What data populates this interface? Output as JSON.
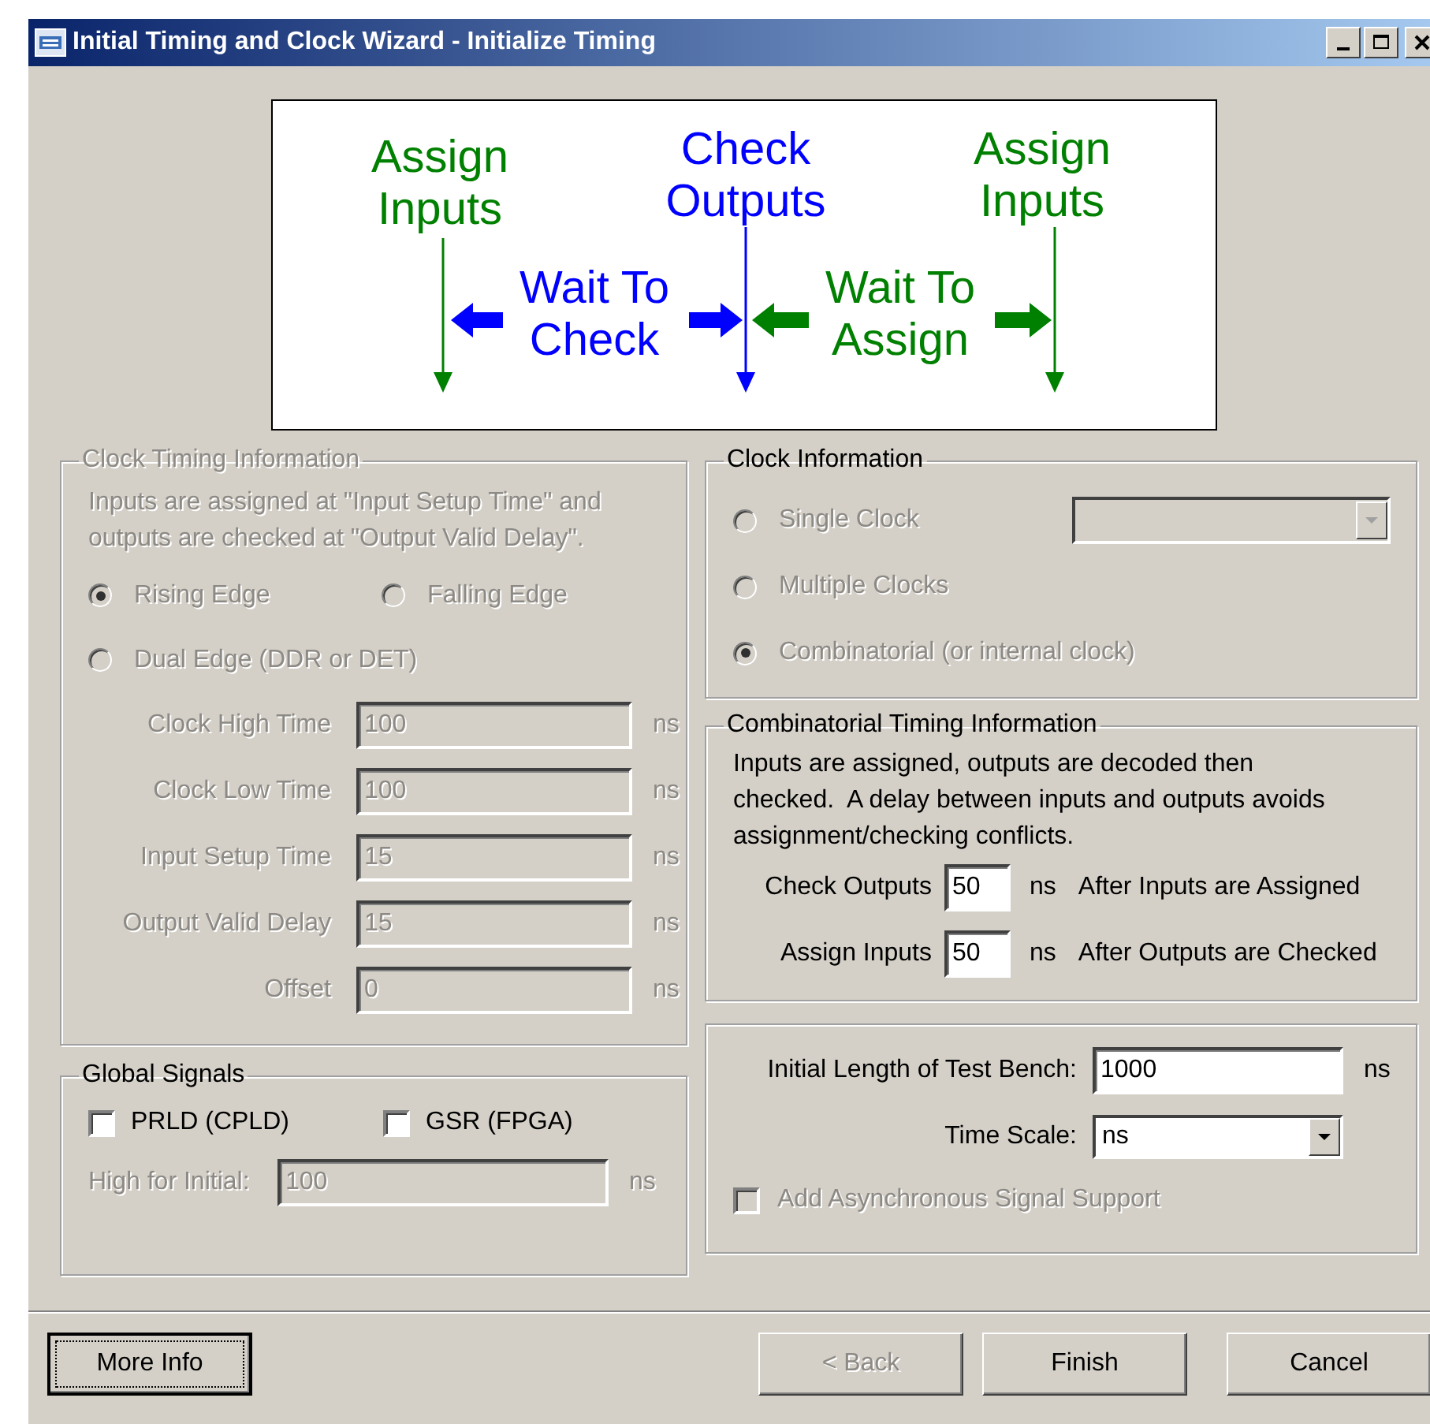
{
  "window": {
    "title": "Initial Timing and Clock Wizard - Initialize Timing"
  },
  "diagram": {
    "labels": [
      {
        "lines": [
          "Assign",
          "Inputs"
        ],
        "color": "#008000"
      },
      {
        "lines": [
          "Check",
          "Outputs"
        ],
        "color": "#0000ff"
      },
      {
        "lines": [
          "Assign",
          "Inputs"
        ],
        "color": "#008000"
      },
      {
        "lines": [
          "Wait To",
          "Check"
        ],
        "color": "#0000ff"
      },
      {
        "lines": [
          "Wait To",
          "Assign"
        ],
        "color": "#008000"
      }
    ]
  },
  "clock_timing": {
    "title": "Clock Timing Information",
    "disabled": true,
    "description": "Inputs are assigned at \"Input Setup Time\" and outputs are checked at \"Output Valid Delay\".",
    "edge_options": [
      {
        "label": "Rising Edge",
        "selected": true
      },
      {
        "label": "Falling Edge",
        "selected": false
      },
      {
        "label": "Dual Edge (DDR or DET)",
        "selected": false
      }
    ],
    "fields": [
      {
        "label": "Clock High Time",
        "value": "100",
        "unit": "ns"
      },
      {
        "label": "Clock Low Time",
        "value": "100",
        "unit": "ns"
      },
      {
        "label": "Input Setup Time",
        "value": "15",
        "unit": "ns"
      },
      {
        "label": "Output Valid Delay",
        "value": "15",
        "unit": "ns"
      },
      {
        "label": "Offset",
        "value": "0",
        "unit": "ns"
      }
    ]
  },
  "clock_information": {
    "title": "Clock Information",
    "disabled": true,
    "options": [
      {
        "label": "Single Clock",
        "selected": false
      },
      {
        "label": "Multiple Clocks",
        "selected": false
      },
      {
        "label": "Combinatorial (or internal clock)",
        "selected": true
      }
    ]
  },
  "combinatorial_timing": {
    "title": "Combinatorial Timing Information",
    "description_lines": [
      "Inputs are assigned, outputs are decoded then",
      "checked.  A delay between inputs and outputs avoids",
      "assignment/checking conflicts."
    ],
    "fields": [
      {
        "label": "Check Outputs",
        "value": "50",
        "unit": "ns",
        "note": "After Inputs are Assigned"
      },
      {
        "label": "Assign Inputs",
        "value": "50",
        "unit": "ns",
        "note": "After Outputs are Checked"
      }
    ]
  },
  "global_signals": {
    "title": "Global Signals",
    "checkboxes": [
      {
        "label": "PRLD (CPLD)",
        "checked": false
      },
      {
        "label": "GSR (FPGA)",
        "checked": false
      }
    ],
    "high_for_initial": {
      "label": "High for Initial:",
      "value": "100",
      "unit": "ns",
      "disabled": true
    }
  },
  "test_bench": {
    "length": {
      "label": "Initial Length of Test Bench:",
      "value": "1000",
      "unit": "ns"
    },
    "time_scale": {
      "label": "Time Scale:",
      "value": "ns"
    },
    "async_support": {
      "label": "Add Asynchronous Signal Support",
      "checked": false,
      "disabled": true
    }
  },
  "footer": {
    "left_buttons": [
      {
        "label": "More Info",
        "disabled": false,
        "focused": true
      }
    ],
    "right_buttons": [
      {
        "label": "< Back",
        "disabled": true,
        "focused": false
      },
      {
        "label": "Finish",
        "disabled": false,
        "focused": false
      },
      {
        "label": "Cancel",
        "disabled": false,
        "focused": false
      }
    ]
  }
}
